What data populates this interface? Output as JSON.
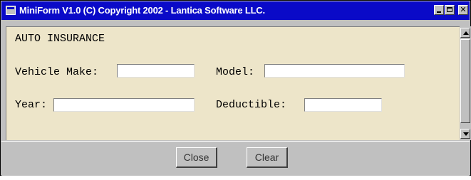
{
  "window": {
    "title": "MiniForm V1.0 (C) Copyright 2002 - Lantica Software LLC.",
    "controls": {
      "close_glyph": "✕"
    }
  },
  "form": {
    "heading": "AUTO INSURANCE",
    "fields": {
      "vehicle_make": {
        "label": "Vehicle Make:",
        "value": ""
      },
      "model": {
        "label": "Model:",
        "value": ""
      },
      "year": {
        "label": "Year:",
        "value": ""
      },
      "deductible": {
        "label": "Deductible:",
        "value": ""
      }
    }
  },
  "buttons": {
    "close": "Close",
    "clear": "Clear"
  },
  "colors": {
    "titlebar": "#0a0ac8",
    "form_background": "#ede5c9",
    "chrome": "#c0c0c0"
  }
}
